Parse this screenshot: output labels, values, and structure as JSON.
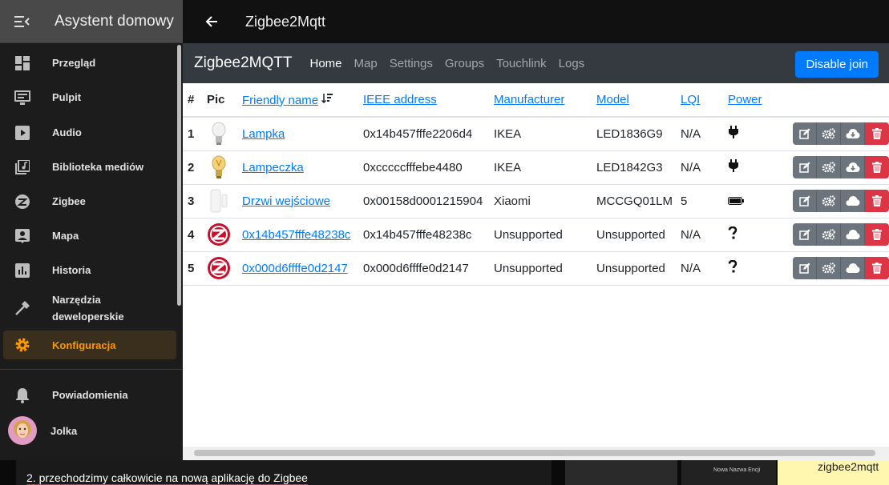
{
  "sidebar": {
    "title": "Asystent domowy",
    "items": [
      {
        "label": "Przegląd",
        "icon": "dashboard-icon"
      },
      {
        "label": "Pulpit",
        "icon": "monitor-icon"
      },
      {
        "label": "Audio",
        "icon": "play-icon"
      },
      {
        "label": "Biblioteka mediów",
        "icon": "media-library-icon"
      },
      {
        "label": "Zigbee",
        "icon": "zigbee-icon"
      },
      {
        "label": "Mapa",
        "icon": "map-icon"
      },
      {
        "label": "Historia",
        "icon": "chart-icon"
      },
      {
        "label": "Narzędzia deweloperskie",
        "icon": "hammer-icon"
      },
      {
        "label": "Konfiguracja",
        "icon": "gear-icon",
        "active": true
      },
      {
        "label": "Powiadomienia",
        "icon": "bell-icon"
      },
      {
        "label": "Jolka",
        "icon": "avatar"
      }
    ],
    "active_color": "#ff9800"
  },
  "topbar": {
    "title": "Zigbee2Mqtt"
  },
  "z2m": {
    "brand": "Zigbee2MQTT",
    "links": [
      "Home",
      "Map",
      "Settings",
      "Groups",
      "Touchlink",
      "Logs"
    ],
    "active_link": "Home",
    "disable_join": "Disable join"
  },
  "table": {
    "headers": {
      "num": "#",
      "pic": "Pic",
      "name": "Friendly name",
      "ieee": "IEEE address",
      "manufacturer": "Manufacturer",
      "model": "Model",
      "lqi": "LQI",
      "power": "Power"
    },
    "rows": [
      {
        "num": "1",
        "pic": "bulb",
        "name": "Lampka",
        "ieee": "0x14b457fffe2206d4",
        "manufacturer": "IKEA",
        "model": "LED1836G9",
        "lqi": "N/A",
        "power": "plug-icon",
        "cloud": "cloud-download-icon"
      },
      {
        "num": "2",
        "pic": "bulb-amber",
        "name": "Lampeczka",
        "ieee": "0xcccccfffebe4480",
        "manufacturer": "IKEA",
        "model": "LED1842G3",
        "lqi": "N/A",
        "power": "plug-icon",
        "cloud": "cloud-download-icon"
      },
      {
        "num": "3",
        "pic": "sensor",
        "name": "Drzwi wejściowe",
        "ieee": "0x00158d0001215904",
        "manufacturer": "Xiaomi",
        "model": "MCCGQ01LM",
        "lqi": "5",
        "power": "battery-icon",
        "cloud": "cloud-icon"
      },
      {
        "num": "4",
        "pic": "zigbee",
        "name": "0x14b457fffe48238c",
        "ieee": "0x14b457fffe48238c",
        "manufacturer": "Unsupported",
        "model": "Unsupported",
        "lqi": "N/A",
        "power": "question-icon",
        "cloud": "cloud-icon"
      },
      {
        "num": "5",
        "pic": "zigbee",
        "name": "0x000d6ffffe0d2147",
        "ieee": "0x000d6ffffe0d2147",
        "manufacturer": "Unsupported",
        "model": "Unsupported",
        "lqi": "N/A",
        "power": "question-icon",
        "cloud": "cloud-icon"
      }
    ]
  },
  "bottom": {
    "caption": "2. przechodzimy całkowicie na nową aplikację do Zigbee",
    "small_label": "Nowa Nazwa Encji",
    "right_text": "zigbee2mqtt"
  }
}
